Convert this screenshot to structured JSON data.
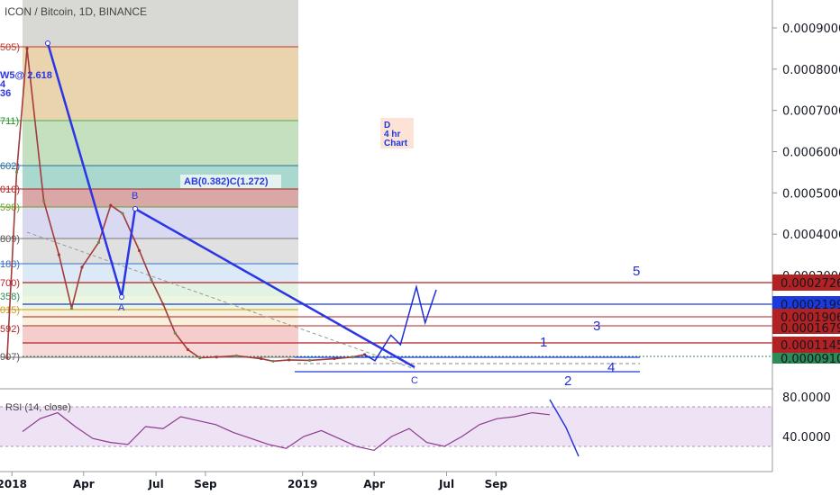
{
  "title": "ICON / Bitcoin, 1D, BINANCE",
  "colors": {
    "pattern": "#2a36e6",
    "wave": "#1e2fd6",
    "red": "#b22222",
    "blue": "#1a3adf",
    "rsi": "#8e3a8e",
    "candleUp": "#6d8a4d",
    "candleDown": "#a33b3b"
  },
  "annotations": {
    "pattern_ratio": "AB(0.382)C(1.272)",
    "chart_note": [
      "D",
      "4 hr",
      "Chart"
    ],
    "point_a": "A",
    "point_b": "B",
    "point_c": "C",
    "top_left": [
      "W5@ 2.618",
      "4",
      "36"
    ],
    "waves": [
      "1",
      "2",
      "3",
      "4",
      "5"
    ]
  },
  "fib_labels": [
    "505)",
    "711)",
    "602)",
    "010)",
    "598)",
    "809)",
    "188)",
    "700)",
    "358)",
    "015)",
    "592)",
    "907)"
  ],
  "price_badges": [
    {
      "value": "0.0002726",
      "color": "#b22222"
    },
    {
      "value": "0.0002199",
      "color": "#1a3adf"
    },
    {
      "value": "0.0001906",
      "color": "#b22222"
    },
    {
      "value": "0.0001679",
      "color": "#b22222"
    },
    {
      "value": "0.0001145",
      "color": "#b22222"
    },
    {
      "value": "0.0000910",
      "color": "#2e8b57"
    }
  ],
  "rsi": {
    "label": "RSI (14, close)",
    "ticks": [
      "80.0000",
      "40.0000"
    ]
  },
  "chart_data": {
    "type": "line",
    "title": "ICON / Bitcoin, 1D, BINANCE",
    "y_ticks": [
      "0.0009000",
      "0.0008000",
      "0.0007000",
      "0.0006000",
      "0.0005000",
      "0.0004000",
      "0.0003000"
    ],
    "x_ticks": [
      "2018",
      "Apr",
      "Jul",
      "Sep",
      "2019",
      "Apr",
      "Jul",
      "Sep"
    ],
    "ylim": [
      7e-05,
      0.00095
    ],
    "series": [
      {
        "x": [
          "2017-12-26",
          "2018-01-07",
          "2018-01-20",
          "2018-02-10",
          "2018-03-01",
          "2018-03-17",
          "2018-03-30",
          "2018-04-20",
          "2018-05-05",
          "2018-05-20",
          "2018-06-10",
          "2018-06-25",
          "2018-07-10",
          "2018-07-25",
          "2018-08-10",
          "2018-08-25",
          "2018-09-15",
          "2018-10-10",
          "2018-11-10",
          "2018-11-25",
          "2018-12-15",
          "2019-01-10",
          "2019-02-10",
          "2019-03-05",
          "2019-03-20"
        ],
        "values": [
          0.0001,
          0.00055,
          0.00085,
          0.00048,
          0.00035,
          0.00022,
          0.00032,
          0.00038,
          0.00047,
          0.00045,
          0.00036,
          0.00029,
          0.00023,
          0.00016,
          0.00012,
          0.0001,
          0.000102,
          0.000105,
          9.8e-05,
          9.2e-05,
          9.5e-05,
          9.4e-05,
          9.8e-05,
          0.000102,
          0.000108
        ]
      }
    ],
    "projection": {
      "x": [
        "2019-03-20",
        "2019-04-02",
        "2019-04-22",
        "2019-05-04",
        "2019-05-24",
        "2019-06-04",
        "2019-06-18"
      ],
      "values": [
        0.000108,
        9.3e-05,
        0.000155,
        0.000132,
        0.000272,
        0.000185,
        0.000265
      ]
    },
    "rsi_values": [
      55,
      68,
      74,
      60,
      48,
      44,
      42,
      60,
      58,
      70,
      66,
      62,
      54,
      48,
      42,
      38,
      50,
      56,
      48,
      40,
      36,
      50,
      58,
      44,
      40,
      50,
      62,
      68,
      70,
      74,
      72
    ]
  }
}
